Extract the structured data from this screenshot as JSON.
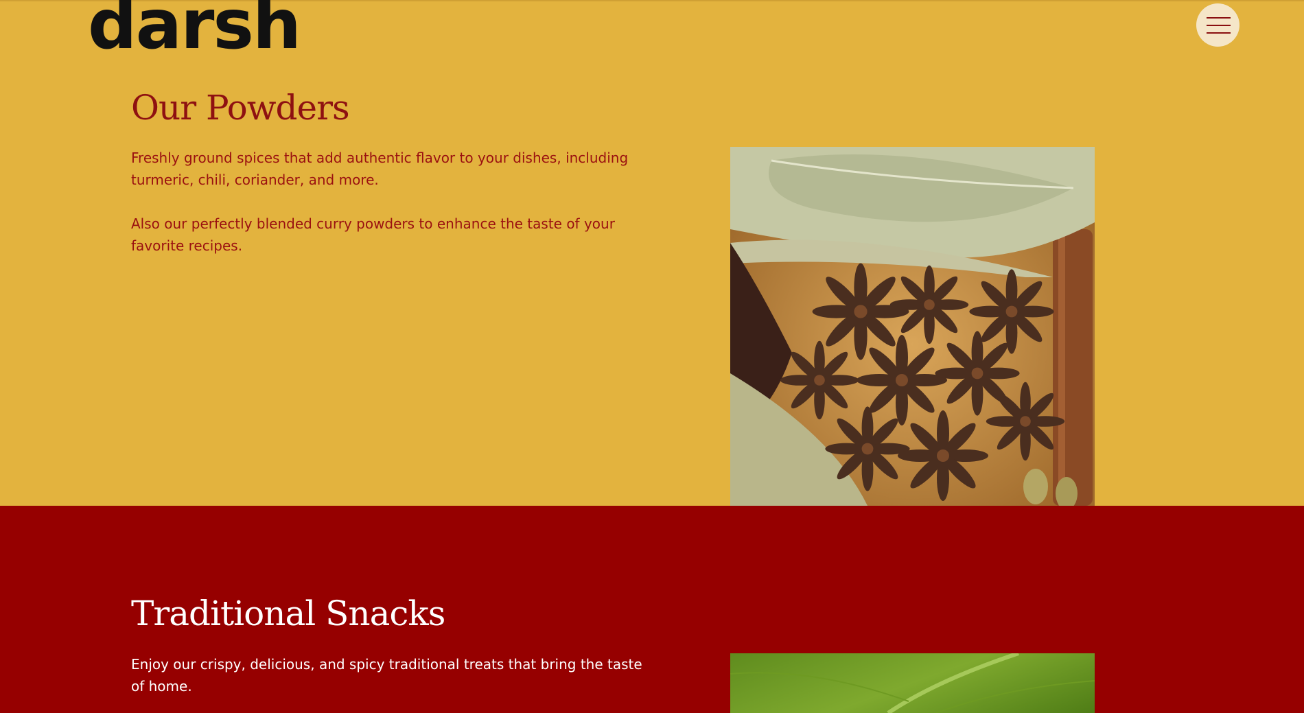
{
  "header": {
    "logo_text": "darsh",
    "menu_icon": "hamburger-menu-icon"
  },
  "powders": {
    "title": "Our Powders",
    "paragraph_1": "Freshly ground spices that add authentic flavor to your dishes, including turmeric, chili, coriander, and more.",
    "paragraph_2": "Also our perfectly blended curry powders to enhance the taste of your favorite recipes."
  },
  "snacks": {
    "title": "Traditional Snacks",
    "paragraph_1": "Enjoy our crispy, delicious, and spicy traditional treats that bring the taste of home."
  },
  "colors": {
    "mustard_background": "#e3b33e",
    "maroon_background": "#960000",
    "maroon_text": "#8e1111",
    "menu_button": "#f5e6c8"
  }
}
